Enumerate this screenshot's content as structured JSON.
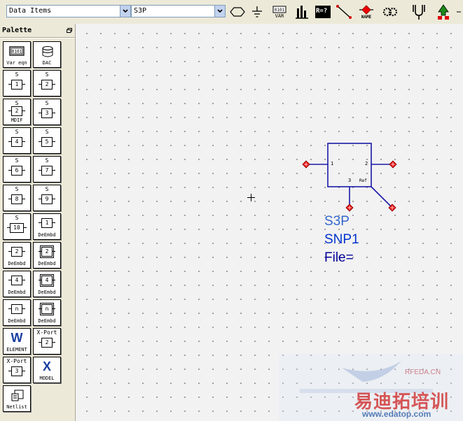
{
  "toolbar": {
    "library_combo": "Data Items",
    "component_combo": "S3P",
    "var_label": "VAR",
    "num_label": "R=?",
    "name_label": "NAME"
  },
  "palette": {
    "title": "Palette",
    "items": [
      {
        "top": "",
        "text": "",
        "label": "Var eqn"
      },
      {
        "top": "",
        "text": "",
        "label": "DAC"
      },
      {
        "top": "S",
        "text": "1",
        "label": ""
      },
      {
        "top": "S",
        "text": "2",
        "label": ""
      },
      {
        "top": "S",
        "text": "2",
        "label": "MDIF"
      },
      {
        "top": "S",
        "text": "3",
        "label": ""
      },
      {
        "top": "S",
        "text": "4",
        "label": ""
      },
      {
        "top": "S",
        "text": "5",
        "label": ""
      },
      {
        "top": "S",
        "text": "6",
        "label": ""
      },
      {
        "top": "S",
        "text": "7",
        "label": ""
      },
      {
        "top": "S",
        "text": "8",
        "label": ""
      },
      {
        "top": "S",
        "text": "9",
        "label": ""
      },
      {
        "top": "S",
        "text": "10",
        "label": ""
      },
      {
        "top": "",
        "text": "1",
        "label": "DeEmbd"
      },
      {
        "top": "",
        "text": "2",
        "label": "DeEmbd"
      },
      {
        "top": "",
        "text": "2",
        "label": "DeEmbd"
      },
      {
        "top": "",
        "text": "4",
        "label": "DeEmbd"
      },
      {
        "top": "",
        "text": "4",
        "label": "DeEmbd"
      },
      {
        "top": "",
        "text": "n",
        "label": "DeEmbd"
      },
      {
        "top": "",
        "text": "n",
        "label": "DeEmbd"
      },
      {
        "top": "",
        "text": "W",
        "label": "ELEMENT"
      },
      {
        "top": "X-Port",
        "text": "2",
        "label": ""
      },
      {
        "top": "X-Port",
        "text": "3",
        "label": ""
      },
      {
        "top": "",
        "text": "X",
        "label": "MODEL"
      },
      {
        "top": "",
        "text": "",
        "label": "Netlist"
      }
    ]
  },
  "component": {
    "port1": "1",
    "port2": "2",
    "port3": "3",
    "ref": "Ref",
    "type": "S3P",
    "instance": "SNP1",
    "file": "File=",
    "type_color": "#3366cc",
    "instance_color": "#0033cc",
    "file_color": "#000099"
  },
  "watermark": {
    "line1": "RFEDA.CN",
    "line2": "易迪拓培训",
    "line3": "www.edatop.com"
  }
}
